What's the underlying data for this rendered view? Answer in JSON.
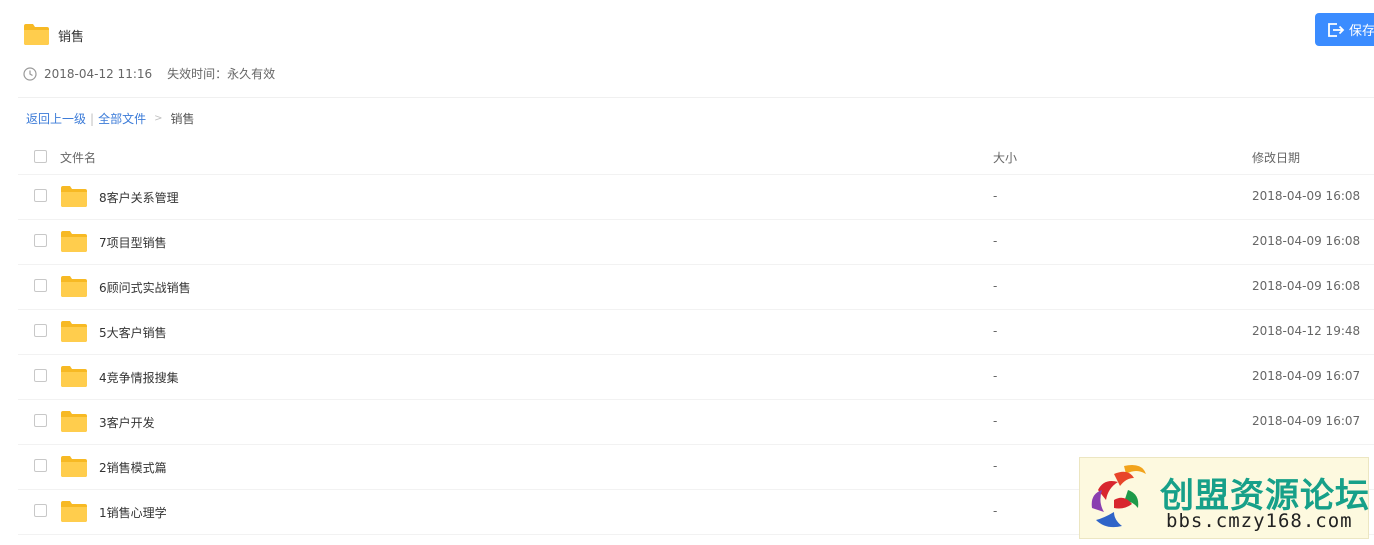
{
  "share": {
    "title": "销售",
    "created": "2018-04-12 11:16",
    "expire": "失效时间：永久有效",
    "save_label": "保存"
  },
  "breadcrumb": {
    "back": "返回上一级",
    "all_files": "全部文件",
    "current": "销售"
  },
  "columns": {
    "name": "文件名",
    "size": "大小",
    "date": "修改日期"
  },
  "files": [
    {
      "name": "8客户关系管理",
      "size": "-",
      "date": "2018-04-09 16:08"
    },
    {
      "name": "7项目型销售",
      "size": "-",
      "date": "2018-04-09 16:08"
    },
    {
      "name": "6顾问式实战销售",
      "size": "-",
      "date": "2018-04-09 16:08"
    },
    {
      "name": "5大客户销售",
      "size": "-",
      "date": "2018-04-12 19:48"
    },
    {
      "name": "4竞争情报搜集",
      "size": "-",
      "date": "2018-04-09 16:07"
    },
    {
      "name": "3客户开发",
      "size": "-",
      "date": "2018-04-09 16:07"
    },
    {
      "name": "2销售模式篇",
      "size": "-",
      "date": ""
    },
    {
      "name": "1销售心理学",
      "size": "-",
      "date": ""
    }
  ],
  "watermark": {
    "title": "创盟资源论坛",
    "url": "bbs.cmzy168.com"
  },
  "colors": {
    "accent": "#3b8cff",
    "folder": "#ffc94d",
    "link": "#3b7bd8",
    "watermark_text": "#17a089"
  }
}
